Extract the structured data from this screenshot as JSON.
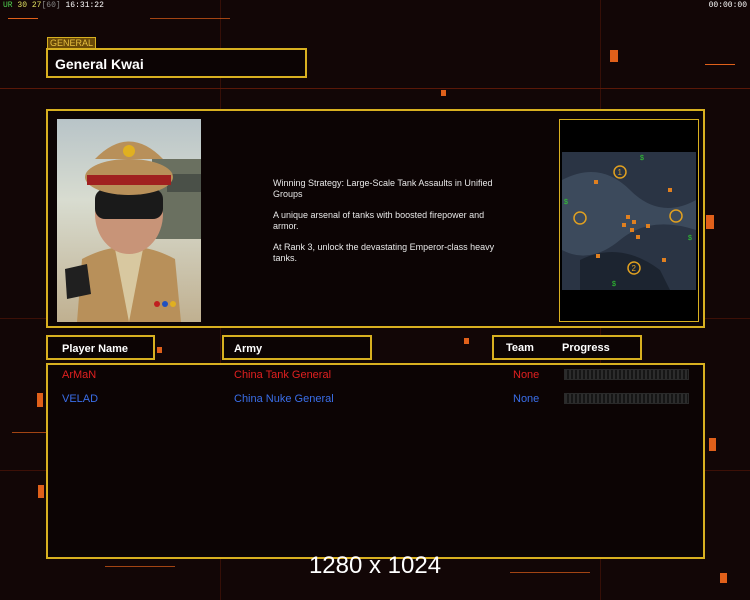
{
  "hud": {
    "ur_label": "UR",
    "fps": "30",
    "count": "27",
    "limit": "60",
    "clock": "16:31:22",
    "timer": "00:00:00"
  },
  "general": {
    "tag": "GENERAL",
    "name": "General Kwai"
  },
  "description": {
    "strategy": "Winning Strategy: Large-Scale Tank Assaults in Unified Groups",
    "arsenal": "A unique arsenal of tanks with boosted firepower and armor.",
    "rank": "At Rank 3, unlock the devastating Emperor-class heavy tanks."
  },
  "map": {
    "start_1": "1",
    "start_2": "2",
    "money_symbol": "$"
  },
  "columns": {
    "player": "Player Name",
    "army": "Army",
    "team": "Team",
    "progress": "Progress"
  },
  "players": [
    {
      "name": "ArMaN",
      "army": "China Tank General",
      "team": "None",
      "color": "#e02020",
      "progress": 0
    },
    {
      "name": "VELAD",
      "army": "China Nuke General",
      "team": "None",
      "color": "#3a6ee8",
      "progress": 0
    }
  ],
  "resolution": "1280 x 1024",
  "colors": {
    "border": "#d8b020",
    "accent": "#e0601a"
  }
}
